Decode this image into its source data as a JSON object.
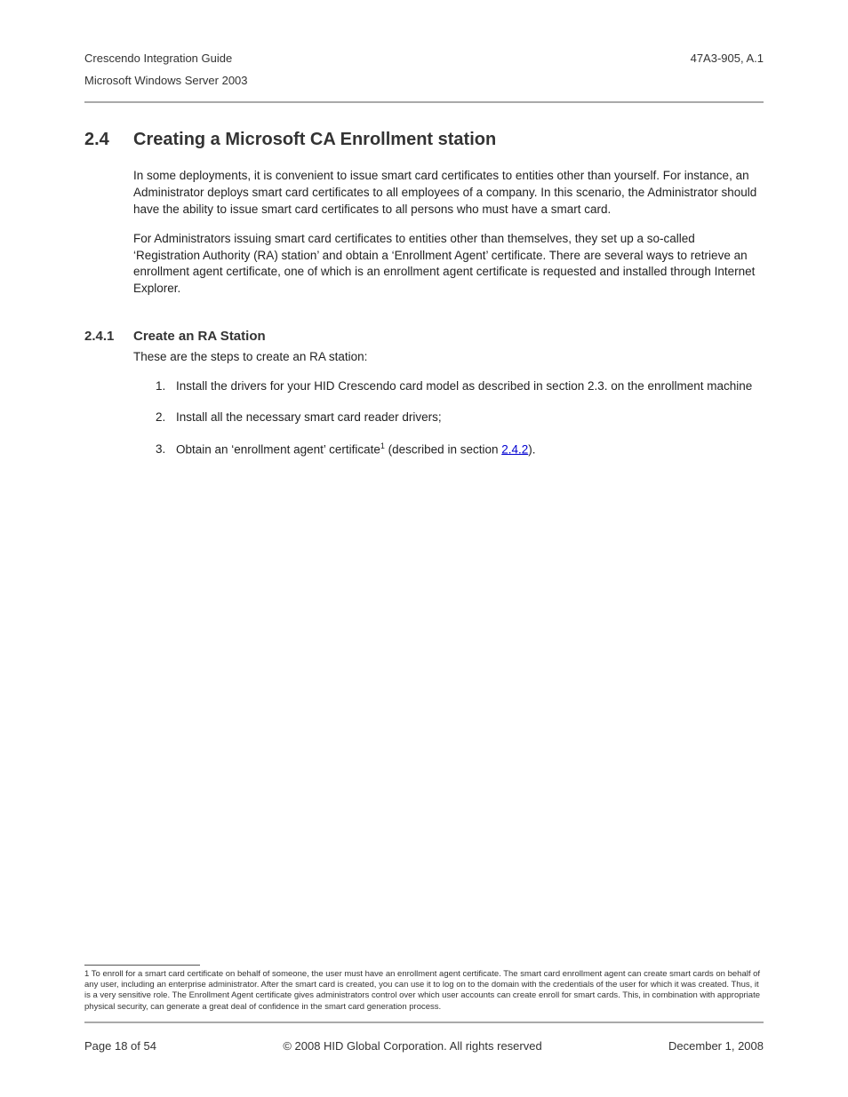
{
  "header": {
    "title": "Crescendo Integration Guide",
    "subtitle": "Microsoft Windows Server 2003",
    "doc_number": "47A3-905, A.1"
  },
  "section": {
    "number": "2.4",
    "title": "Creating a Microsoft CA Enrollment station",
    "para1": "In some deployments, it is convenient to issue smart card certificates to entities other than yourself. For instance, an Administrator deploys smart card certificates to all employees of a company. In this scenario, the Administrator should have the ability to issue smart card certificates to all persons who must have a smart card.",
    "para2": "For Administrators issuing smart card certificates to entities other than themselves, they set up a so-called ‘Registration Authority (RA) station’ and obtain a ‘Enrollment Agent’ certificate. There are several ways to retrieve an enrollment agent certificate, one of which is an enrollment agent certificate is requested and installed through Internet Explorer."
  },
  "subsection": {
    "number": "2.4.1",
    "title": "Create an RA Station",
    "intro": "These are the steps to create an RA station:",
    "steps": {
      "s1": "Install the drivers for your HID Crescendo card model as described in section 2.3. on the enrollment machine",
      "s2": "Install all the necessary smart card reader drivers;",
      "s3_pre": "Obtain an ‘enrollment agent’ certificate",
      "s3_sup": "1",
      "s3_mid": " (described in section ",
      "s3_link": "2.4.2",
      "s3_post": ")."
    }
  },
  "footnote": {
    "marker": "1",
    "text": " To enroll for a smart card certificate on behalf of someone, the user must have an enrollment agent certificate. The smart card enrollment agent can create smart cards on behalf of any user, including an enterprise administrator. After the smart card is created, you can use it to log on to the domain with the credentials of the user for which it was created. Thus, it is a very sensitive role. The Enrollment Agent certificate gives administrators control over which user accounts can create enroll for smart cards. This, in combination with appropriate physical security, can generate a great deal of confidence in the smart card generation process."
  },
  "footer": {
    "page": "Page 18 of 54",
    "copyright": "© 2008 HID Global Corporation.  All rights reserved",
    "date": "December 1, 2008"
  }
}
